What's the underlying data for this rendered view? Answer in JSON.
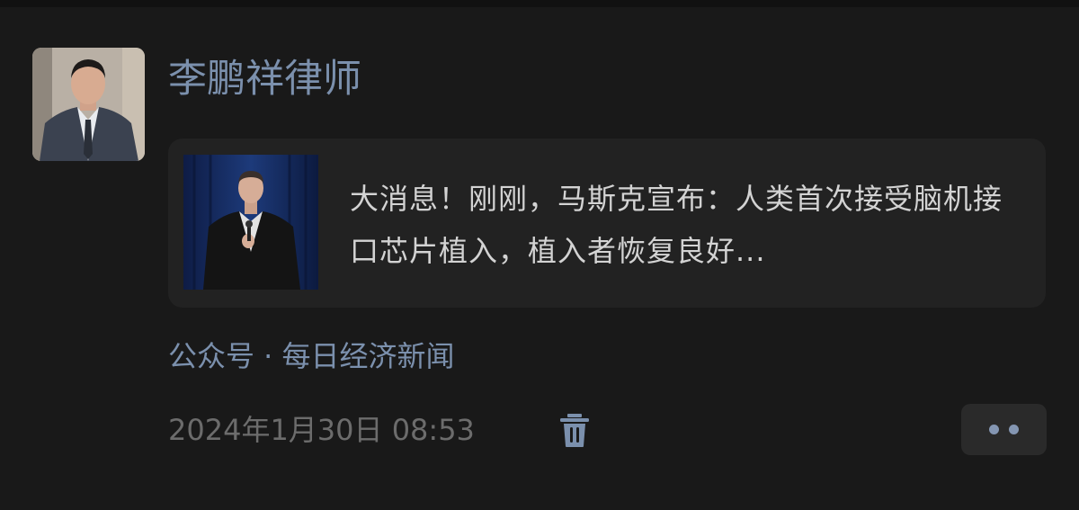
{
  "post": {
    "author_name": "李鹏祥律师",
    "article": {
      "title": "大消息！刚刚，马斯克宣布：人类首次接受脑机接口芯片植入，植入者恢复良好..."
    },
    "source_label": "公众号 · 每日经济新闻",
    "timestamp": "2024年1月30日 08:53"
  },
  "icons": {
    "delete": "trash-icon",
    "more": "more-dots-icon"
  },
  "colors": {
    "background": "#191919",
    "card_background": "#222222",
    "link_blue": "#7b90ad",
    "title_text": "#d3d3d3",
    "muted_text": "#6c6c6c"
  }
}
